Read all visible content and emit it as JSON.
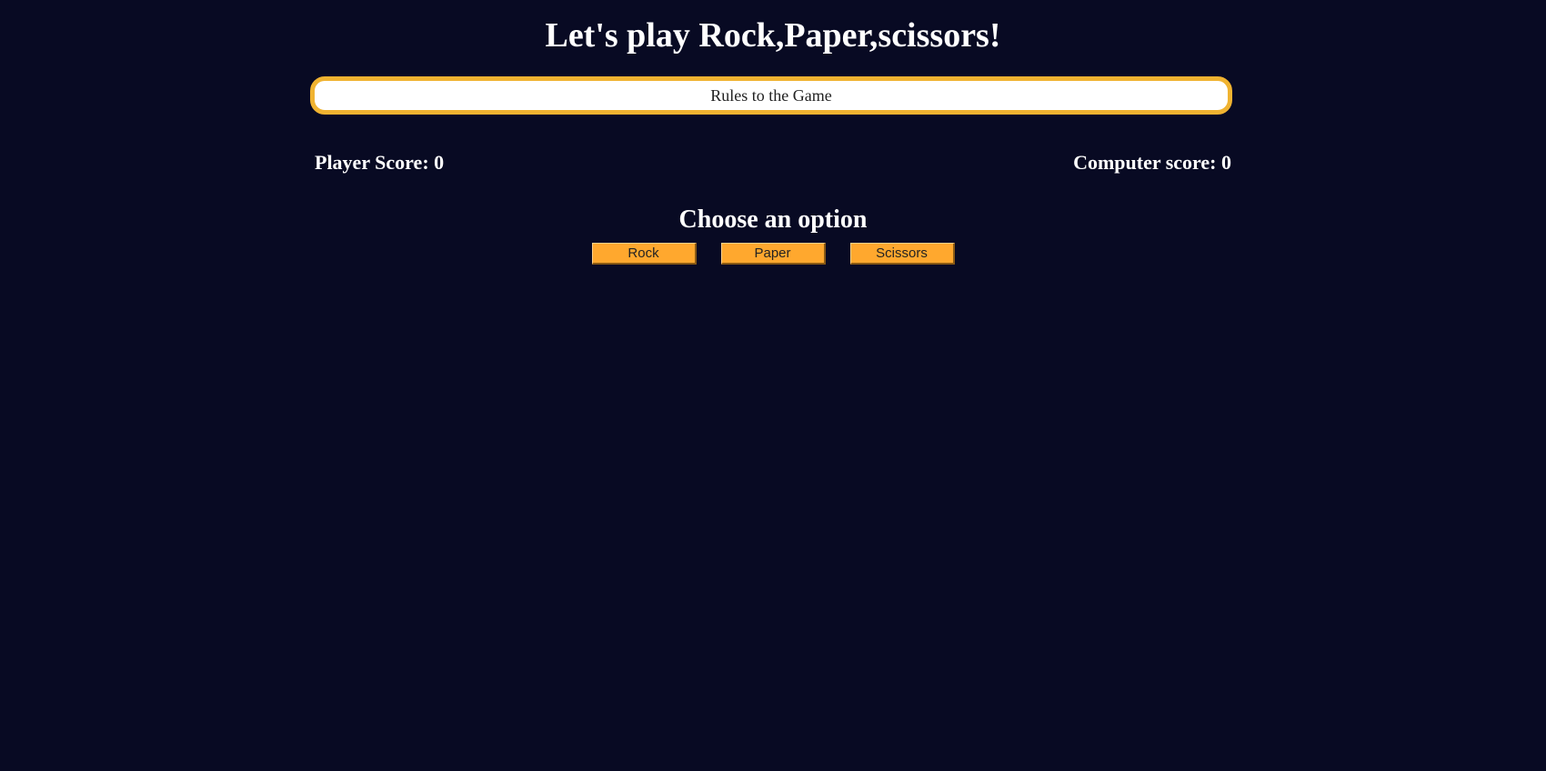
{
  "header": {
    "title": "Let's play Rock,Paper,scissors!"
  },
  "rules": {
    "label": "Rules to the Game"
  },
  "scores": {
    "player_label": "Player Score: 0",
    "computer_label": "Computer score: 0"
  },
  "options": {
    "heading": "Choose an option",
    "buttons": [
      "Rock",
      "Paper",
      "Scissors"
    ]
  },
  "colors": {
    "background": "#080a23",
    "rules_border": "#f0b331",
    "button": "#ffa82e"
  }
}
